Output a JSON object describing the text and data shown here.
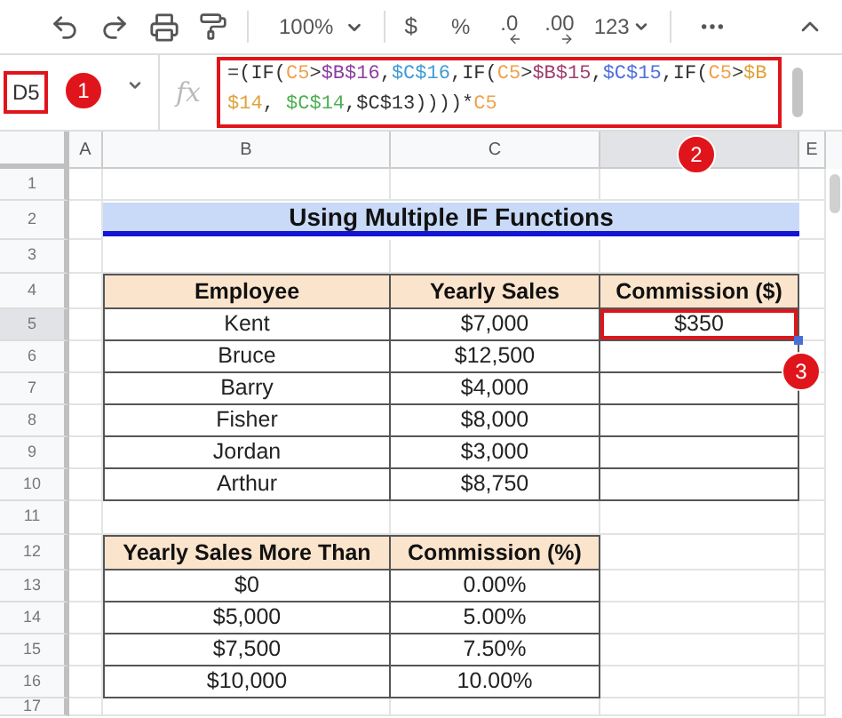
{
  "toolbar": {
    "zoom": "100%",
    "currency": "$",
    "percent": "%",
    "decrease_decimals": ".0",
    "increase_decimals": ".00",
    "number_format": "123"
  },
  "name_box": "D5",
  "fx": "fx",
  "formula": [
    {
      "text": "=(IF(",
      "color": "#333333"
    },
    {
      "text": "C5",
      "color": "#f0a04b"
    },
    {
      "text": ">",
      "color": "#333333"
    },
    {
      "text": "$B$16",
      "color": "#8e3ea0"
    },
    {
      "text": ",",
      "color": "#333333"
    },
    {
      "text": "$C$16",
      "color": "#3f9bd6"
    },
    {
      "text": ",IF(",
      "color": "#333333"
    },
    {
      "text": "C5",
      "color": "#f0a04b"
    },
    {
      "text": ">",
      "color": "#333333"
    },
    {
      "text": "$B$15",
      "color": "#a03d6e"
    },
    {
      "text": ",",
      "color": "#333333"
    },
    {
      "text": "$C$15",
      "color": "#4f6fdc"
    },
    {
      "text": ",IF(",
      "color": "#333333"
    },
    {
      "text": "C5",
      "color": "#f0a04b"
    },
    {
      "text": ">",
      "color": "#333333"
    },
    {
      "text": "$B$14",
      "color": "#e0a23a"
    },
    {
      "text": ", ",
      "color": "#333333"
    },
    {
      "text": "$C$14",
      "color": "#4caf50"
    },
    {
      "text": ",$C$13))))*",
      "color": "#333333"
    },
    {
      "text": "C5",
      "color": "#f0a04b"
    }
  ],
  "columns": [
    {
      "label": "A",
      "selected": false
    },
    {
      "label": "B",
      "selected": false
    },
    {
      "label": "C",
      "selected": false
    },
    {
      "selected": true
    },
    {
      "label": "E",
      "selected": false
    }
  ],
  "row_headers": [
    {
      "label": "1",
      "selected": false
    },
    {
      "label": "2",
      "selected": false
    },
    {
      "label": "3",
      "selected": false
    },
    {
      "label": "4",
      "selected": false
    },
    {
      "label": "5",
      "selected": true
    },
    {
      "label": "6",
      "selected": false
    },
    {
      "label": "7",
      "selected": false
    },
    {
      "label": "8",
      "selected": false
    },
    {
      "label": "9",
      "selected": false
    },
    {
      "label": "10",
      "selected": false
    },
    {
      "label": "11",
      "selected": false
    },
    {
      "label": "12",
      "selected": false
    },
    {
      "label": "13",
      "selected": false
    },
    {
      "label": "14",
      "selected": false
    },
    {
      "label": "15",
      "selected": false
    },
    {
      "label": "16",
      "selected": false
    },
    {
      "label": "17",
      "selected": false
    }
  ],
  "title": "Using Multiple IF Functions",
  "employees": {
    "columns": [
      "Employee",
      "Yearly Sales",
      "Commission ($)"
    ],
    "rows": [
      {
        "employee": "Kent",
        "yearly_sales": "$7,000",
        "commission": "$350",
        "selected": true
      },
      {
        "employee": "Bruce",
        "yearly_sales": "$12,500",
        "selected": false
      },
      {
        "employee": "Barry",
        "yearly_sales": "$4,000",
        "selected": false
      },
      {
        "employee": "Fisher",
        "yearly_sales": "$8,000",
        "selected": false
      },
      {
        "employee": "Jordan",
        "yearly_sales": "$3,000",
        "selected": false
      },
      {
        "employee": "Arthur",
        "yearly_sales": "$8,750",
        "selected": false
      }
    ]
  },
  "rates": {
    "columns": [
      "Yearly Sales More Than",
      "Commission (%)"
    ],
    "rows": [
      {
        "sales": "$0",
        "commission": "0.00%"
      },
      {
        "sales": "$5,000",
        "commission": "5.00%"
      },
      {
        "sales": "$7,500",
        "commission": "7.50%"
      },
      {
        "sales": "$10,000",
        "commission": "10.00%"
      }
    ]
  },
  "markers": [
    "1",
    "2",
    "3"
  ]
}
